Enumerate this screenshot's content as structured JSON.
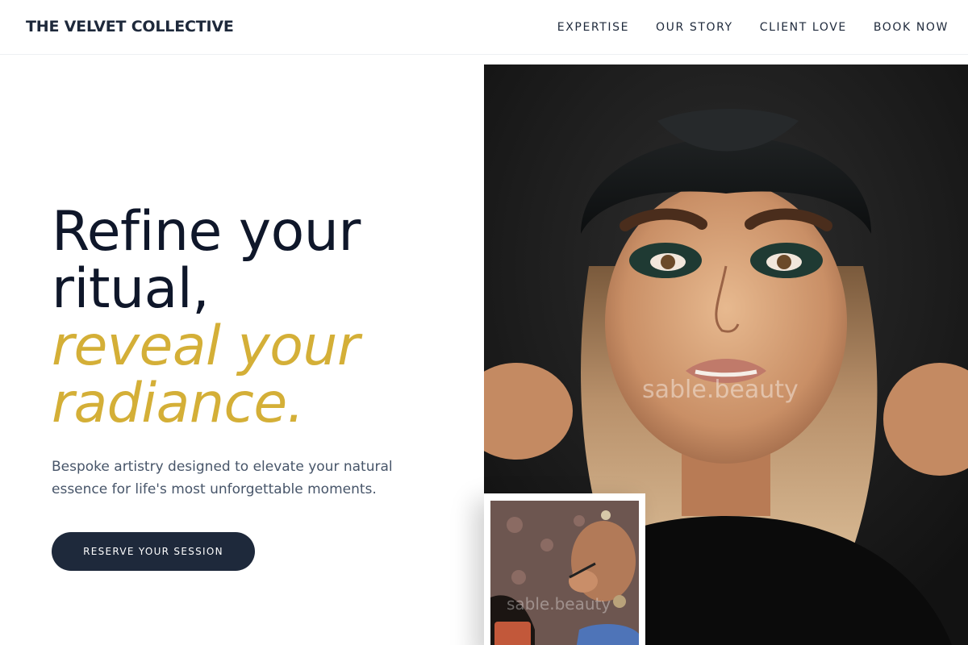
{
  "header": {
    "brand": "THE VELVET COLLECTIVE",
    "nav": [
      {
        "label": "EXPERTISE"
      },
      {
        "label": "OUR STORY"
      },
      {
        "label": "CLIENT LOVE"
      },
      {
        "label": "BOOK NOW"
      }
    ]
  },
  "hero": {
    "title_line1": "Refine your ritual,",
    "title_accent": "reveal your radiance.",
    "subtitle": "Bespoke artistry designed to elevate your natural essence for life's most unforgettable moments.",
    "cta_label": "RESERVE YOUR SESSION"
  },
  "images": {
    "main_watermark": "sable.beauty",
    "inset_watermark": "sable.beauty"
  },
  "colors": {
    "accent_gold": "#d4af37",
    "navy": "#1e293b",
    "text_dark": "#0f172a",
    "text_muted": "#475569"
  }
}
